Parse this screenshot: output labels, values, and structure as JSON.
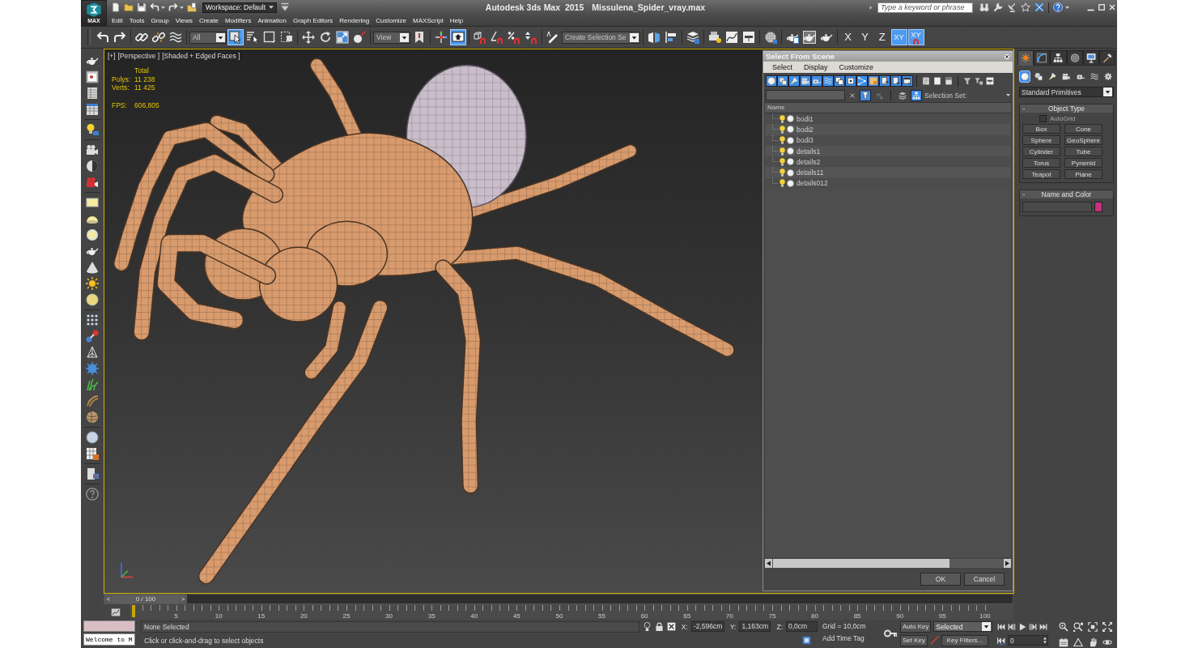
{
  "title_bar": {
    "app_button": "MAX",
    "workspace": "Workspace: Default",
    "product": "Autodesk 3ds Max  2015",
    "file_name": "Missulena_Spider_vray.max",
    "search": {
      "placeholder": "Type a keyword or phrase"
    }
  },
  "menu_bar": [
    "Edit",
    "Tools",
    "Group",
    "Views",
    "Create",
    "Modifiers",
    "Animation",
    "Graph Editors",
    "Rendering",
    "Customize",
    "MAXScript",
    "Help"
  ],
  "main_toolbar": {
    "groups": [
      [
        {
          "kind": "tool",
          "selected": false
        },
        {
          "kind": "tool",
          "selected": false
        }
      ],
      [
        {
          "kind": "tool",
          "selected": false
        },
        {
          "kind": "tool",
          "selected": false
        },
        {
          "kind": "tool",
          "selected": false
        }
      ],
      [
        {
          "kind": "dropdown",
          "value": "All"
        },
        {
          "kind": "tool",
          "selected": true
        },
        {
          "kind": "tool",
          "selected": false
        },
        {
          "kind": "tool",
          "selected": false
        },
        {
          "kind": "tool",
          "selected": false
        }
      ],
      [
        {
          "kind": "tool",
          "selected": false
        },
        {
          "kind": "tool",
          "selected": false
        },
        {
          "kind": "tool",
          "selected": false
        },
        {
          "kind": "tool",
          "selected": false
        }
      ],
      [
        {
          "kind": "dropdown",
          "value": "View"
        },
        {
          "kind": "tool",
          "selected": false
        }
      ],
      [
        {
          "kind": "tool",
          "selected": false
        },
        {
          "kind": "tool",
          "selected": true
        }
      ],
      [
        {
          "kind": "tool",
          "selected": false
        },
        {
          "kind": "tool",
          "selected": false
        },
        {
          "kind": "tool",
          "selected": false
        },
        {
          "kind": "tool",
          "selected": false
        }
      ],
      [
        {
          "kind": "tool",
          "selected": false
        },
        {
          "kind": "dropdown",
          "value": "Create Selection Se"
        }
      ],
      [
        {
          "kind": "tool",
          "selected": false
        },
        {
          "kind": "tool",
          "selected": false
        }
      ],
      [
        {
          "kind": "tool",
          "selected": false
        }
      ],
      [
        {
          "kind": "tool",
          "selected": false
        },
        {
          "kind": "tool",
          "selected": false
        },
        {
          "kind": "tool",
          "selected": false
        }
      ],
      [
        {
          "kind": "tool",
          "selected": false
        }
      ],
      [
        {
          "kind": "tool",
          "selected": false
        },
        {
          "kind": "tool",
          "selected": false
        },
        {
          "kind": "tool",
          "selected": false
        }
      ]
    ],
    "axis_constraints": [
      {
        "kind": "axis",
        "label": "X",
        "selected": false
      },
      {
        "kind": "axis",
        "label": "Y",
        "selected": false
      },
      {
        "kind": "axis",
        "label": "Z",
        "selected": false
      },
      {
        "kind": "axis",
        "label": "XY",
        "selected": true
      },
      {
        "kind": "snap_toggle",
        "label": "XY",
        "selected": true
      }
    ]
  },
  "viewport": {
    "labels": [
      "[+]",
      "[Perspective ]",
      "[Shaded + Edged Faces ]"
    ],
    "stats": {
      "heading": "Total",
      "rows": [
        {
          "label": "Polys:",
          "value": "11 238"
        },
        {
          "label": "Verts:",
          "value": "11 425"
        }
      ],
      "fps": {
        "label": "FPS:",
        "value": "606,805"
      }
    }
  },
  "dialog": {
    "title": "Select From Scene",
    "menu": [
      "Select",
      "Display",
      "Customize"
    ],
    "filters": [
      {
        "selected": true
      },
      {
        "selected": true
      },
      {
        "selected": true
      },
      {
        "selected": true
      },
      {
        "selected": true
      },
      {
        "selected": true
      },
      {
        "selected": true
      },
      {
        "selected": true
      },
      {
        "selected": true
      },
      {
        "selected": true
      },
      {
        "selected": true
      },
      {
        "selected": true
      },
      {
        "selected": true
      }
    ],
    "search_toggles": [
      {
        "selected": true,
        "disabled": false
      },
      {
        "selected": false,
        "disabled": true
      },
      {
        "selected": false,
        "disabled": false
      },
      {
        "selected": true,
        "disabled": false
      }
    ],
    "selection_set_label": "Selection Set:",
    "column": "Name",
    "objects": [
      {
        "name": "bodi1",
        "visible": true,
        "selected": false
      },
      {
        "name": "bodi2",
        "visible": true,
        "selected": false
      },
      {
        "name": "bodi3",
        "visible": true,
        "selected": false
      },
      {
        "name": "details1",
        "visible": true,
        "selected": false
      },
      {
        "name": "details2",
        "visible": true,
        "selected": false
      },
      {
        "name": "details11",
        "visible": true,
        "selected": false
      },
      {
        "name": "details012",
        "visible": true,
        "selected": false
      }
    ],
    "buttons": [
      "OK",
      "Cancel"
    ]
  },
  "command_panel": {
    "tabs": [
      {
        "selected": true
      },
      {
        "selected": false
      },
      {
        "selected": false
      },
      {
        "selected": false
      },
      {
        "selected": false
      },
      {
        "selected": false
      }
    ],
    "categories": [
      {
        "selected": true
      },
      {
        "selected": false
      },
      {
        "selected": false
      },
      {
        "selected": false
      },
      {
        "selected": false
      },
      {
        "selected": false
      },
      {
        "selected": false
      }
    ],
    "category_dropdown": "Standard Primitives",
    "object_type": {
      "collapse_sign": "-",
      "title": "Object Type",
      "autogrid": {
        "label": "AutoGrid",
        "checked": false
      },
      "buttons": [
        "Box",
        "Cone",
        "Sphere",
        "GeoSphere",
        "Cylinder",
        "Tube",
        "Torus",
        "Pyramid",
        "Teapot",
        "Plane"
      ]
    },
    "name_and_color": {
      "collapse_sign": "-",
      "title": "Name and Color",
      "color": "#c8307e"
    }
  },
  "time_slider": {
    "prev": "<",
    "position": "0 / 100",
    "next": ">"
  },
  "timeline": {
    "labels": [
      "5",
      "10",
      "15",
      "20",
      "25",
      "30",
      "35",
      "40",
      "45",
      "50",
      "55",
      "60",
      "65",
      "70",
      "75",
      "80",
      "85",
      "90",
      "95",
      "100"
    ]
  },
  "status": {
    "listener_output": "Welcome to M",
    "selection": "None Selected",
    "prompt": "Click or click-and-drag to select objects",
    "coordinates": [
      {
        "axis": "X:",
        "value": "-2,596cm"
      },
      {
        "axis": "Y:",
        "value": "1,163cm"
      },
      {
        "axis": "Z:",
        "value": "0,0cm"
      }
    ],
    "grid": "Grid = 10,0cm",
    "time_tag": "Add Time Tag"
  },
  "animation": {
    "auto_key": {
      "label": "Auto Key",
      "on": false
    },
    "key_mode": "Selected",
    "set_key": "Set Key",
    "key_filters": "Key Filters...",
    "frame": "0"
  }
}
